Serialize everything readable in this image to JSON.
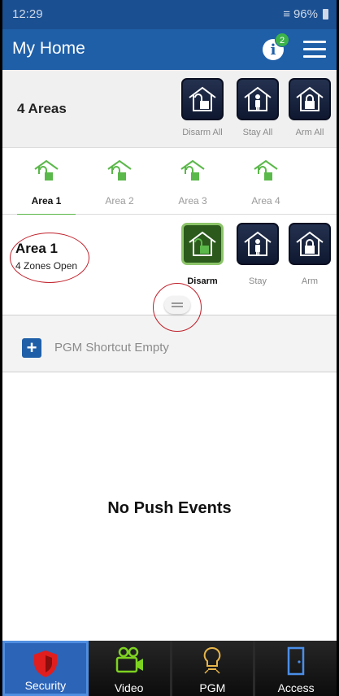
{
  "status_bar": {
    "time": "12:29",
    "battery": "96%"
  },
  "app_bar": {
    "title": "My Home",
    "notification_count": "2"
  },
  "all_areas": {
    "label": "4 Areas",
    "buttons": [
      {
        "label": "Disarm All",
        "icon": "house-unlocked-icon"
      },
      {
        "label": "Stay All",
        "icon": "house-person-icon"
      },
      {
        "label": "Arm All",
        "icon": "house-locked-icon"
      }
    ]
  },
  "tabs": [
    {
      "label": "Area 1",
      "active": true
    },
    {
      "label": "Area 2",
      "active": false
    },
    {
      "label": "Area 3",
      "active": false
    },
    {
      "label": "Area 4",
      "active": false
    }
  ],
  "area_detail": {
    "name": "Area 1",
    "status": "4 Zones Open",
    "buttons": [
      {
        "label": "Disarm",
        "icon": "house-unlocked-icon",
        "active": true
      },
      {
        "label": "Stay",
        "icon": "house-person-icon",
        "active": false
      },
      {
        "label": "Arm",
        "icon": "house-locked-icon",
        "active": false
      }
    ]
  },
  "pgm_shortcut": {
    "text": "PGM Shortcut Empty"
  },
  "events": {
    "empty_text": "No Push Events"
  },
  "bottom_nav": [
    {
      "label": "Security",
      "icon": "shield-icon",
      "active": true
    },
    {
      "label": "Video",
      "icon": "camera-icon",
      "active": false
    },
    {
      "label": "PGM",
      "icon": "bulb-icon",
      "active": false
    },
    {
      "label": "Access",
      "icon": "door-icon",
      "active": false
    }
  ],
  "colors": {
    "app_bar": "#1f5fa8",
    "accent_green": "#5bb84a",
    "annotation_red": "#c0202a"
  }
}
